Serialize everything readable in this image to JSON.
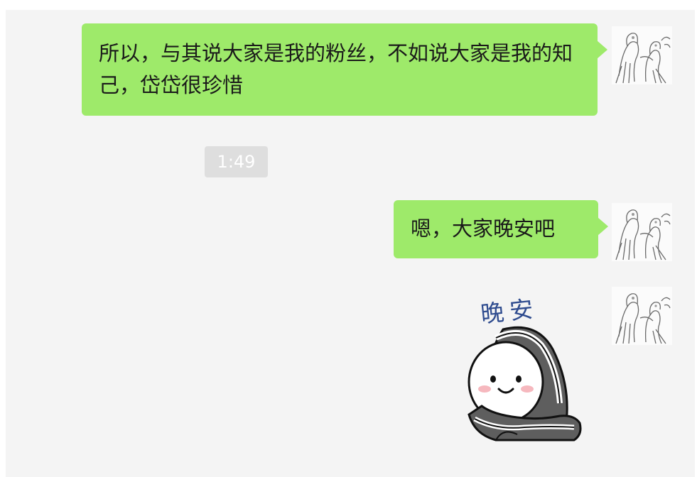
{
  "chat": {
    "messages": [
      {
        "sender": "self",
        "text": "所以，与其说大家是我的粉丝，不如说大家是我的知己，岱岱很珍惜"
      },
      {
        "sender": "self",
        "text": "嗯，大家晚安吧"
      },
      {
        "sender": "self",
        "type": "sticker",
        "caption": "晚安",
        "icon": "sleepy-blanket-dumpling-sticker"
      }
    ],
    "timestamp": "1:49"
  },
  "colors": {
    "panel_bg": "#f4f4f4",
    "bubble_bg": "#9eea6a",
    "time_badge_bg": "#dedede",
    "sticker_text": "#2f4c8f"
  }
}
